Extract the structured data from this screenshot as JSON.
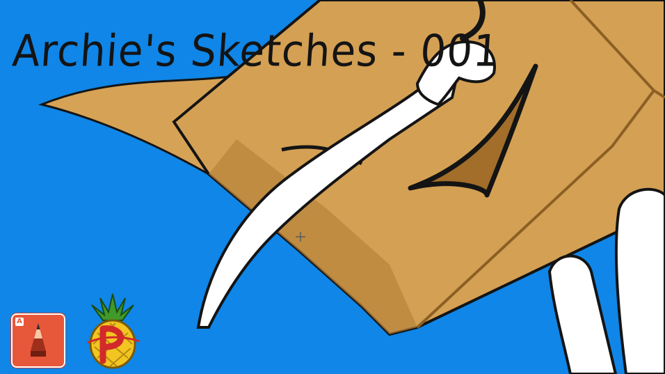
{
  "title": "Archie's Sketches - 001",
  "app_icon": {
    "name": "sketchbook-pencil-icon",
    "badge": "A"
  },
  "logo": {
    "name": "pineapple-letter-p-logo"
  },
  "colors": {
    "background": "#0f86e8",
    "box": "#d4a054",
    "box_shadow": "#a9772f",
    "outline": "#141414",
    "arm": "#ffffff",
    "icon": "#e7573a"
  }
}
